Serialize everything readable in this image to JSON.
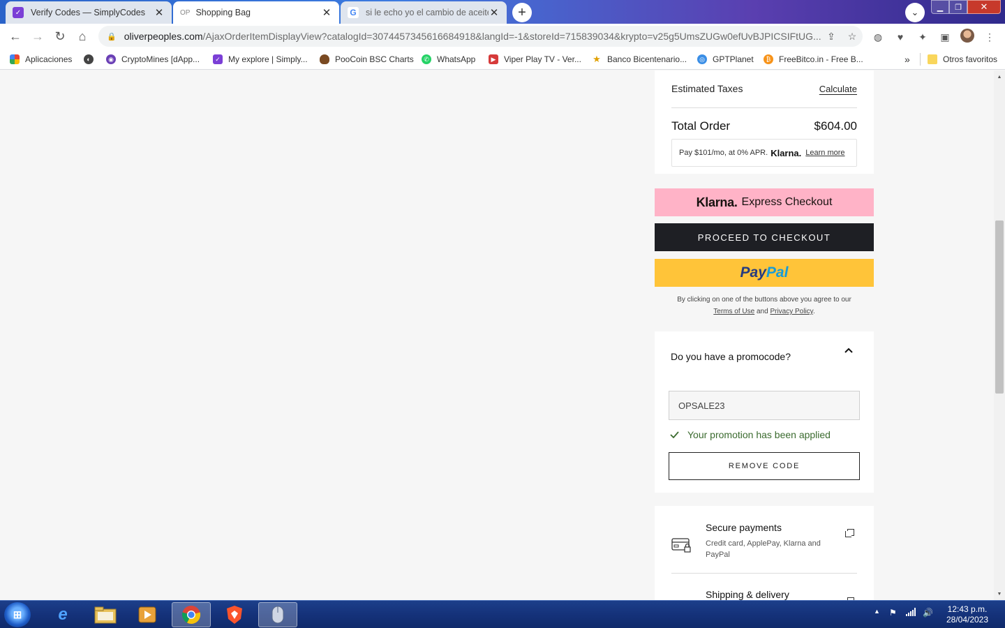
{
  "browser": {
    "tabs": [
      {
        "title": "Verify Codes — SimplyCodes",
        "active": false,
        "favicon": "simplycodes-icon"
      },
      {
        "title": "Shopping Bag",
        "favicon_text": "OP",
        "active": true
      },
      {
        "title": "si le echo yo el cambio de aceite",
        "active": false,
        "favicon": "google-icon"
      }
    ],
    "new_tab": "+",
    "url_host": "oliverpeoples.com",
    "url_path": "/AjaxOrderItemDisplayView?catalogId=3074457345616684918&langId=-1&storeId=715839034&krypto=v25g5UmsZUGw0efUvBJPICSIFtUG...",
    "bookmarks": [
      {
        "label": "Aplicaciones",
        "icon": "apps-grid-icon",
        "color": "#4285f4"
      },
      {
        "label": "",
        "icon": "globe-icon",
        "color": "#444444"
      },
      {
        "label": "CryptoMines [dApp...",
        "icon": "cryptomines-icon",
        "color": "#6a3fb5"
      },
      {
        "label": "My explore | Simply...",
        "icon": "simplycodes-icon",
        "color": "#7b3fd6"
      },
      {
        "label": "PooCoin BSC Charts",
        "icon": "poocoin-icon",
        "color": "#7a4a22"
      },
      {
        "label": "WhatsApp",
        "icon": "whatsapp-icon",
        "color": "#25d366"
      },
      {
        "label": "Viper Play TV - Ver...",
        "icon": "tv-icon",
        "color": "#d63a3a"
      },
      {
        "label": "Banco Bicentenario...",
        "icon": "star-icon",
        "color": "#e0a000"
      },
      {
        "label": "GPTPlanet",
        "icon": "planet-icon",
        "color": "#3a8ee6"
      },
      {
        "label": "FreeBitco.in - Free B...",
        "icon": "bitcoin-icon",
        "color": "#f7931a"
      }
    ],
    "bookmarks_more": "»",
    "other_favorites": "Otros favoritos"
  },
  "summary": {
    "estimated_taxes_label": "Estimated Taxes",
    "calculate_label": "Calculate",
    "total_label": "Total Order",
    "total_value": "$604.00",
    "klarna_note_prefix": "Pay $101/mo, at 0% APR.",
    "klarna_brand": "Klarna.",
    "learn_more": "Learn more"
  },
  "buttons": {
    "klarna_brand": "Klarna.",
    "klarna_express": "Express Checkout",
    "checkout": "PROCEED TO CHECKOUT",
    "paypal_1": "Pay",
    "paypal_2": "Pal"
  },
  "agreement": {
    "text": "By clicking on one of the buttons above you agree to our",
    "terms": "Terms of Use",
    "and": "and",
    "privacy": "Privacy Policy",
    "end": "."
  },
  "promo": {
    "question": "Do you have a promocode?",
    "code": "OPSALE23",
    "applied": "Your promotion has been applied",
    "remove": "REMOVE CODE"
  },
  "services": {
    "secure_title": "Secure payments",
    "secure_desc": "Credit card, ApplePay, Klarna and PayPal",
    "shipping_title": "Shipping & delivery"
  },
  "taskbar": {
    "time": "12:43 p.m.",
    "date": "28/04/2023"
  },
  "colors": {
    "klarna_pink": "#ffb3c7",
    "checkout_dark": "#1e1f24",
    "paypal_yellow": "#ffc439",
    "success_green": "#3b6b2f"
  }
}
